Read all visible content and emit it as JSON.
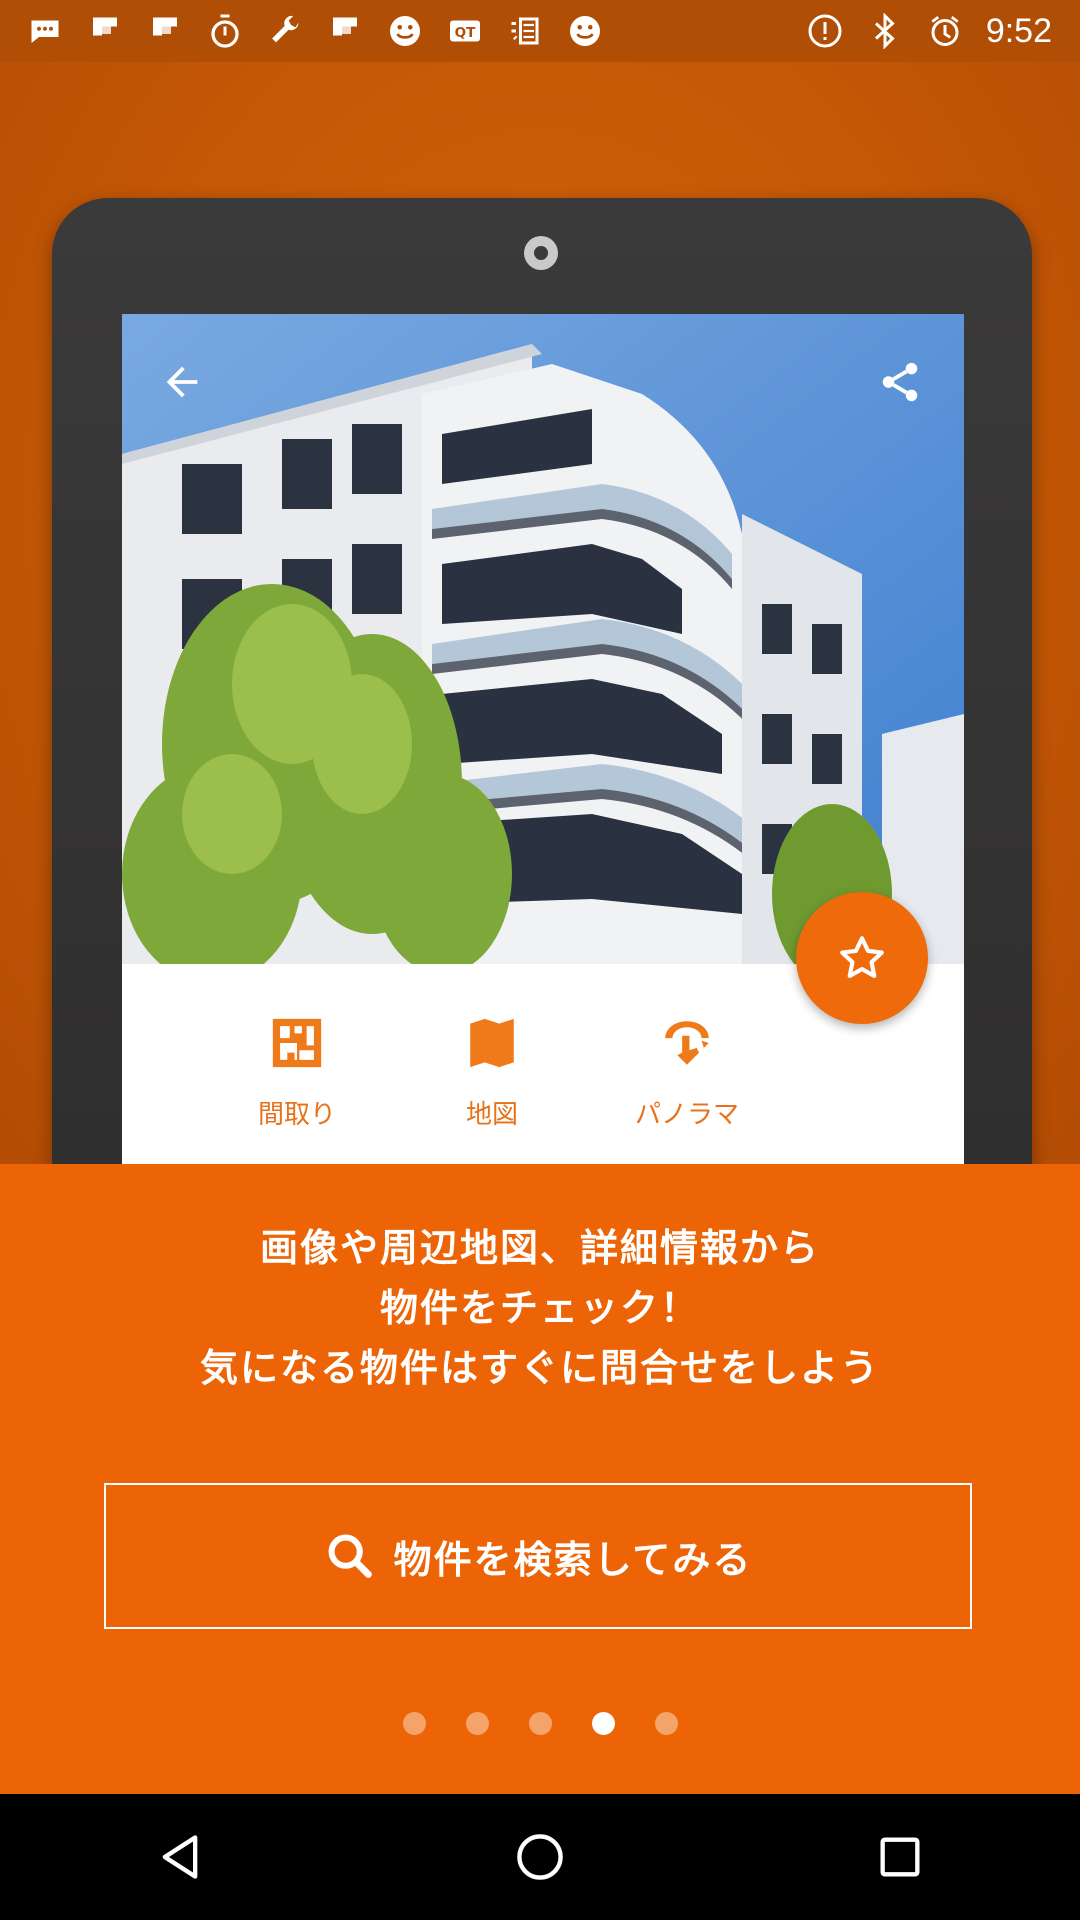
{
  "status_bar": {
    "time": "9:52",
    "left_icons": [
      "chat-bubble-icon",
      "flipboard-icon",
      "flipboard-icon",
      "stopwatch-icon",
      "wrench-icon",
      "flipboard-icon",
      "smiley-icon",
      "qr-app-icon",
      "sake-icon",
      "smiley-icon"
    ],
    "right_icons": [
      "alert-icon",
      "bluetooth-icon",
      "alarm-icon"
    ]
  },
  "tablet_screen": {
    "back_icon": "arrow-back-icon",
    "share_icon": "share-icon",
    "favorite_icon": "star-icon",
    "features": [
      {
        "label": "間取り",
        "icon": "floorplan-icon"
      },
      {
        "label": "地図",
        "icon": "map-icon"
      },
      {
        "label": "パノラマ",
        "icon": "panorama-icon"
      }
    ]
  },
  "description": {
    "lines": [
      "画像や周辺地図、詳細情報から",
      "物件をチェック！",
      "気になる物件はすぐに問合せをしよう"
    ]
  },
  "search_button": {
    "label": "物件を検索してみる",
    "icon": "search-icon"
  },
  "pager": {
    "total": 5,
    "active_index": 3
  },
  "nav_bar": {
    "buttons": [
      "back-triangle-icon",
      "home-circle-icon",
      "recents-square-icon"
    ]
  },
  "colors": {
    "accent": "#ec6406",
    "hero_bg": "#c85a06",
    "feature_orange": "#ef7a1a"
  }
}
